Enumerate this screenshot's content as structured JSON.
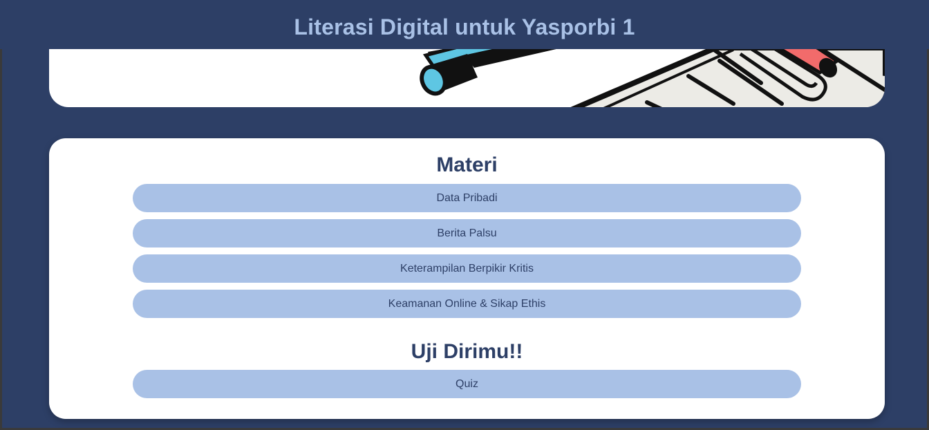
{
  "header": {
    "title": "Literasi Digital untuk Yasporbi 1"
  },
  "hero": {
    "illustration": "pen-and-document-illustration"
  },
  "materi": {
    "heading": "Materi",
    "items": [
      {
        "label": "Data Pribadi"
      },
      {
        "label": "Berita Palsu"
      },
      {
        "label": "Keterampilan Berpikir Kritis"
      },
      {
        "label": "Keamanan Online & Sikap Ethis"
      }
    ]
  },
  "uji": {
    "heading": "Uji Dirimu!!",
    "items": [
      {
        "label": "Quiz"
      }
    ]
  },
  "colors": {
    "background": "#2d3f66",
    "accent": "#a9c1e6",
    "card": "#ffffff",
    "pen_blue": "#5ec6e3",
    "pen_red": "#f26b6b"
  }
}
